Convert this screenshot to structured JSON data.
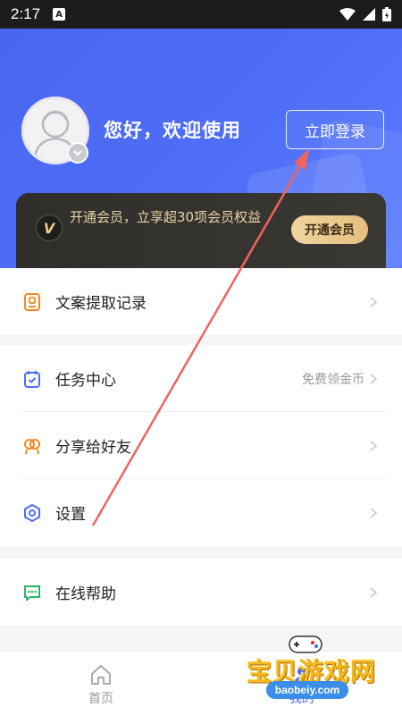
{
  "status_bar": {
    "time": "2:17",
    "notification_letter": "A"
  },
  "header": {
    "greeting": "您好，欢迎使用",
    "login_button": "立即登录"
  },
  "vip": {
    "icon_letter": "V",
    "text": "开通会员，立享超30项会员权益",
    "button": "开通会员"
  },
  "menu": {
    "copy_records": {
      "label": "文案提取记录",
      "icon": "document-icon"
    },
    "task_center": {
      "label": "任务中心",
      "hint": "免费领金币",
      "icon": "calendar-check-icon"
    },
    "share": {
      "label": "分享给好友",
      "icon": "share-icon"
    },
    "settings": {
      "label": "设置",
      "icon": "settings-icon"
    },
    "help": {
      "label": "在线帮助",
      "icon": "chat-icon"
    }
  },
  "tabbar": {
    "home": "首页",
    "mine": "我的"
  },
  "watermark": {
    "title": "宝贝游戏网",
    "url": "baobeiy.com"
  },
  "colors": {
    "primary": "#4e6ef7",
    "vip_gold": "#e8d3a5",
    "vip_dark": "#2f2e2b"
  }
}
